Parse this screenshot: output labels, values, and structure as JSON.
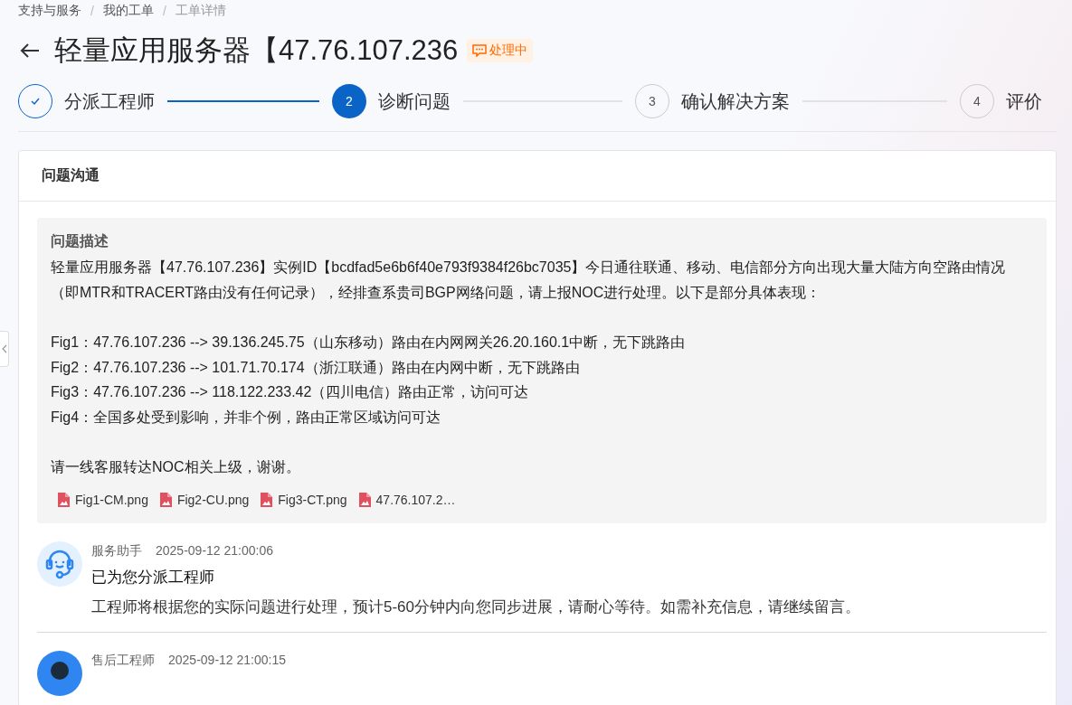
{
  "breadcrumb_separator": "/",
  "breadcrumb": [
    {
      "label": "支持与服务",
      "current": false
    },
    {
      "label": "我的工单",
      "current": false
    },
    {
      "label": "工单详情",
      "current": true
    }
  ],
  "title": "轻量应用服务器【47.76.107.236",
  "status_badge": "处理中",
  "steps": [
    {
      "label": "分派工程师",
      "completed": true,
      "active": false
    },
    {
      "number": "2",
      "label": "诊断问题",
      "completed": false,
      "active": true
    },
    {
      "number": "3",
      "label": "确认解决方案",
      "completed": false,
      "active": false
    },
    {
      "number": "4",
      "label": "评价",
      "completed": false,
      "active": false
    }
  ],
  "panel": {
    "title": "问题沟通",
    "description": {
      "heading": "问题描述",
      "blocks": [
        [
          "轻量应用服务器【47.76.107.236】实例ID【bcdfad5e6b6f40e793f9384f26bc7035】今日通往联通、移动、电信部分方向出现大量大陆方向空路由情况（即MTR和TRACERT路由没有任何记录），经排查系贵司BGP网络问题，请上报NOC进行处理。以下是部分具体表现："
        ],
        [
          "Fig1：47.76.107.236 --> 39.136.245.75（山东移动）路由在内网网关26.20.160.1中断，无下跳路由",
          "Fig2：47.76.107.236 --> 101.71.70.174（浙江联通）路由在内网中断，无下跳路由",
          "Fig3：47.76.107.236 --> 118.122.233.42（四川电信）路由正常，访问可达",
          "Fig4：全国多处受到影响，并非个例，路由正常区域访问可达"
        ],
        [
          "请一线客服转达NOC相关上级，谢谢。"
        ]
      ],
      "attachments": [
        "Fig1-CM.png",
        "Fig2-CU.png",
        "Fig3-CT.png",
        "47.76.107.2…"
      ]
    },
    "messages": [
      {
        "kind": "bot",
        "author": "服务助手",
        "time": "2025-09-12 21:00:06",
        "headline": "已为您分派工程师",
        "body": "工程师将根据您的实际问题进行处理，预计5-60分钟内向您同步进展，请耐心等待。如需补充信息，请继续留言。"
      },
      {
        "kind": "person",
        "author": "售后工程师",
        "time": "2025-09-12 21:00:15"
      }
    ]
  }
}
